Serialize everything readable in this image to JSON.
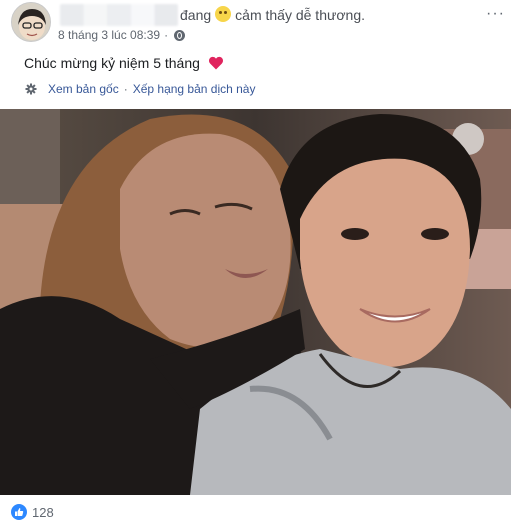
{
  "post": {
    "author_action": "đang",
    "feeling_text": "cảm thấy dễ thương.",
    "feeling_icon": "smiling-face-icon",
    "timestamp": "8 tháng 3 lúc 08:39",
    "separator": "·",
    "privacy_icon": "globe-icon",
    "more_label": "···",
    "text": "Chúc mừng kỷ niệm 5 tháng",
    "text_icon": "heart-icon",
    "translate": {
      "see_original": "Xem bản gốc",
      "separator": "·",
      "rate_translation": "Xếp hạng bản dịch này"
    },
    "photo_icon": "couple-selfie-photo",
    "reactions": {
      "icon": "like-icon",
      "count": "128"
    }
  },
  "colors": {
    "link": "#385898",
    "meta": "#606770",
    "like": "#2d88ff",
    "heart": "#e0245e"
  }
}
